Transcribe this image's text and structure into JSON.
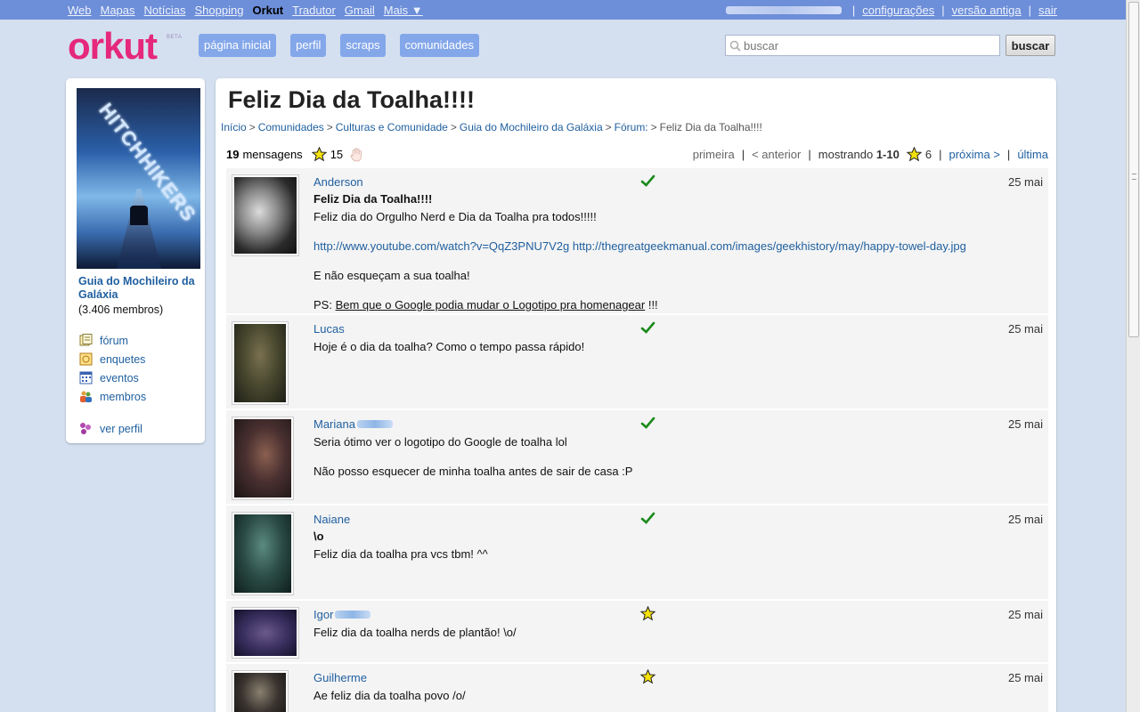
{
  "topnav": {
    "links": [
      "Web",
      "Mapas",
      "Notícias",
      "Shopping",
      "Orkut",
      "Tradutor",
      "Gmail",
      "Mais ▼"
    ],
    "active": "Orkut",
    "right_links": [
      "configurações",
      "versão antiga",
      "sair"
    ]
  },
  "header": {
    "logo": "orkut",
    "beta": "BETA",
    "nav": [
      "página inicial",
      "perfil",
      "scraps",
      "comunidades"
    ],
    "search_placeholder": "buscar",
    "search_button": "buscar"
  },
  "community": {
    "poster_title": "HITCHHIKERS",
    "name": "Guia do Mochileiro da Galáxia",
    "members": "(3.406 membros)",
    "links": [
      {
        "label": "fórum",
        "icon": "forum-icon"
      },
      {
        "label": "enquetes",
        "icon": "polls-icon"
      },
      {
        "label": "eventos",
        "icon": "calendar-icon"
      },
      {
        "label": "membros",
        "icon": "members-icon"
      }
    ],
    "profile_link": "ver perfil"
  },
  "topic": {
    "title": "Feliz Dia da Toalha!!!!",
    "breadcrumb": [
      "Início",
      "Comunidades",
      "Culturas e Comunidade",
      "Guia do Mochileiro da Galáxia",
      "Fórum:"
    ],
    "breadcrumb_current": "Feliz Dia da Toalha!!!!",
    "message_count": "19",
    "message_label": "mensagens",
    "star_count": "15",
    "pager": {
      "first": "primeira",
      "prev": "< anterior",
      "showing_label": "mostrando",
      "showing_range": "1-10",
      "star_count": "6",
      "next": "próxima >",
      "last": "última"
    }
  },
  "posts": [
    {
      "author": "Anderson",
      "mark": "check",
      "date": "25 mai",
      "subject": "Feliz Dia da Toalha!!!!",
      "lines": [
        "Feliz dia do Orgulho Nerd e Dia da Toalha pra todos!!!!!",
        "",
        "E não esqueçam a sua toalha!"
      ],
      "links": "http://www.youtube.com/watch?v=QqZ3PNU7V2g http://thegreatgeekmanual.com/images/geekhistory/may/happy-towel-day.jpg",
      "ps_prefix": "PS: ",
      "ps_underlined": "Bem que o Google podia mudar o Logotipo pra homenagear",
      "ps_suffix": " !!!"
    },
    {
      "author": "Lucas",
      "mark": "check",
      "date": "25 mai",
      "lines": [
        "Hoje é o dia da toalha? Como o tempo passa rápido!"
      ]
    },
    {
      "author": "Mariana",
      "mark": "check",
      "date": "25 mai",
      "lines": [
        "Seria ótimo ver o logotipo do Google de toalha lol",
        "Não posso esquecer de minha toalha antes de sair de casa :P"
      ]
    },
    {
      "author": "Naiane",
      "mark": "check",
      "date": "25 mai",
      "subject": "\\o",
      "lines": [
        "Feliz dia da toalha pra vcs tbm! ^^"
      ]
    },
    {
      "author": "Igor",
      "mark": "star",
      "date": "25 mai",
      "lines": [
        "Feliz dia da toalha nerds de plantão! \\o/"
      ]
    },
    {
      "author": "Guilherme",
      "mark": "star",
      "date": "25 mai",
      "lines": [
        "Ae feliz dia da toalha povo /o/"
      ]
    }
  ],
  "colors": {
    "background": "#d4e0f0",
    "topbar": "#6d8ed8",
    "logo": "#e5287a",
    "nav_button": "#84a7ea",
    "link": "#1f5f9f",
    "check": "#1a8a1a",
    "star": "#f5e10c"
  }
}
